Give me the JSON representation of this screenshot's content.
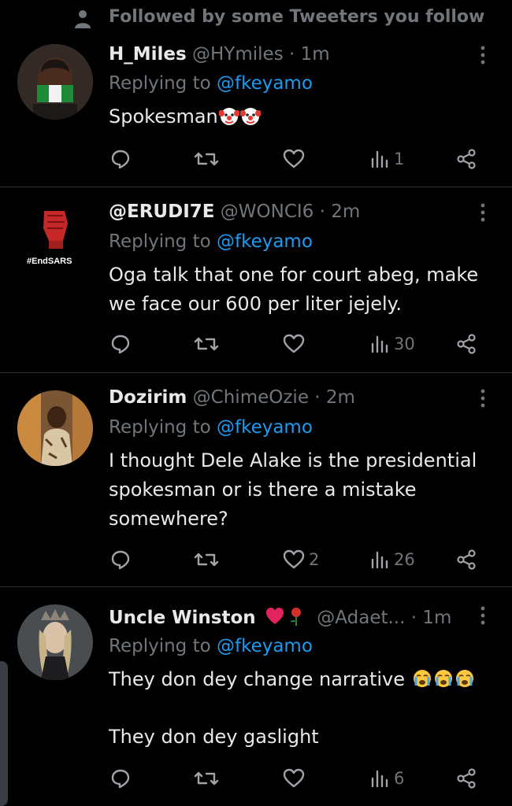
{
  "social_context": {
    "text": "Followed by some Tweeters you follow",
    "icon": "person-icon"
  },
  "tweets": [
    {
      "name": "H_Miles",
      "handle": "@HYmiles",
      "dot": "·",
      "time": "1m",
      "replying_prefix": "Replying to ",
      "replying_to": "@fkeyamo",
      "text": "Spokesman",
      "text_emojis": [
        "clown-face",
        "clown-face"
      ],
      "replies": "",
      "retweets": "",
      "likes": "",
      "views": "1"
    },
    {
      "name": "@ERUDI7E",
      "handle": "@WONCI6",
      "dot": "·",
      "time": "2m",
      "replying_prefix": "Replying to ",
      "replying_to": "@fkeyamo",
      "text": "Oga talk that one for court abeg, make we face our 600 per liter jejely.",
      "avatar_text": "#EndSARS",
      "replies": "",
      "retweets": "",
      "likes": "",
      "views": "30"
    },
    {
      "name": "Dozirim",
      "handle": "@ChimeOzie",
      "dot": "·",
      "time": "2m",
      "replying_prefix": "Replying to ",
      "replying_to": "@fkeyamo",
      "text": "I thought Dele Alake is the presidential spokesman or is there a mistake somewhere?",
      "replies": "",
      "retweets": "",
      "likes": "2",
      "views": "26"
    },
    {
      "name": "Uncle Winston",
      "name_emojis": [
        "red-heart",
        "rose"
      ],
      "handle": "@Adaet...",
      "dot": "·",
      "time": "1m",
      "replying_prefix": "Replying to ",
      "replying_to": "@fkeyamo",
      "text": "They don dey change narrative",
      "text_emojis": [
        "crying-face",
        "crying-face",
        "crying-face"
      ],
      "text2": "They don dey gaslight",
      "replies": "",
      "retweets": "",
      "likes": "",
      "views": "6"
    }
  ],
  "colors": {
    "background": "#000000",
    "text": "#e7e9ea",
    "secondary": "#71767b",
    "link": "#1d9bf0",
    "divider": "#2f3336"
  }
}
